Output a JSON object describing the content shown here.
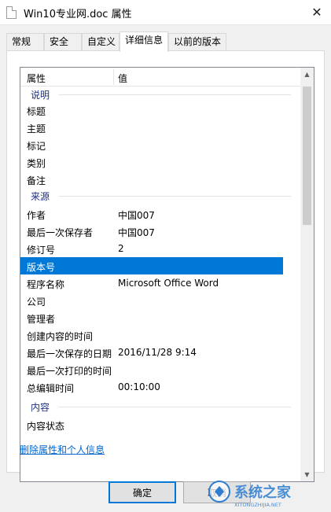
{
  "window": {
    "title": "Win10专业网.doc 属性"
  },
  "tabs": [
    "常规",
    "安全",
    "自定义",
    "详细信息",
    "以前的版本"
  ],
  "columns": {
    "property": "属性",
    "value": "值"
  },
  "groups": {
    "description": "说明",
    "origin": "来源",
    "content": "内容"
  },
  "description_rows": [
    {
      "k": "标题",
      "v": ""
    },
    {
      "k": "主题",
      "v": ""
    },
    {
      "k": "标记",
      "v": ""
    },
    {
      "k": "类别",
      "v": ""
    },
    {
      "k": "备注",
      "v": ""
    }
  ],
  "origin_rows": [
    {
      "k": "作者",
      "v": "中国007"
    },
    {
      "k": "最后一次保存者",
      "v": "中国007"
    },
    {
      "k": "修订号",
      "v": "2"
    },
    {
      "k": "版本号",
      "v": ""
    },
    {
      "k": "程序名称",
      "v": "Microsoft Office Word"
    },
    {
      "k": "公司",
      "v": ""
    },
    {
      "k": "管理者",
      "v": ""
    },
    {
      "k": "创建内容的时间",
      "v": ""
    },
    {
      "k": "最后一次保存的日期",
      "v": "2016/11/28 9:14"
    },
    {
      "k": "最后一次打印的时间",
      "v": ""
    },
    {
      "k": "总编辑时间",
      "v": "00:10:00"
    }
  ],
  "content_rows": [
    {
      "k": "内容状态",
      "v": ""
    }
  ],
  "selected_row": "版本号",
  "link_text": "删除属性和个人信息",
  "buttons": {
    "ok": "确定",
    "cancel": "取消"
  },
  "watermark": {
    "brand": "系统之家",
    "url": "XITONGZHIJIA.NET"
  },
  "colors": {
    "accent": "#0078d7",
    "group_header": "#1e3287",
    "link": "#0066cc"
  }
}
